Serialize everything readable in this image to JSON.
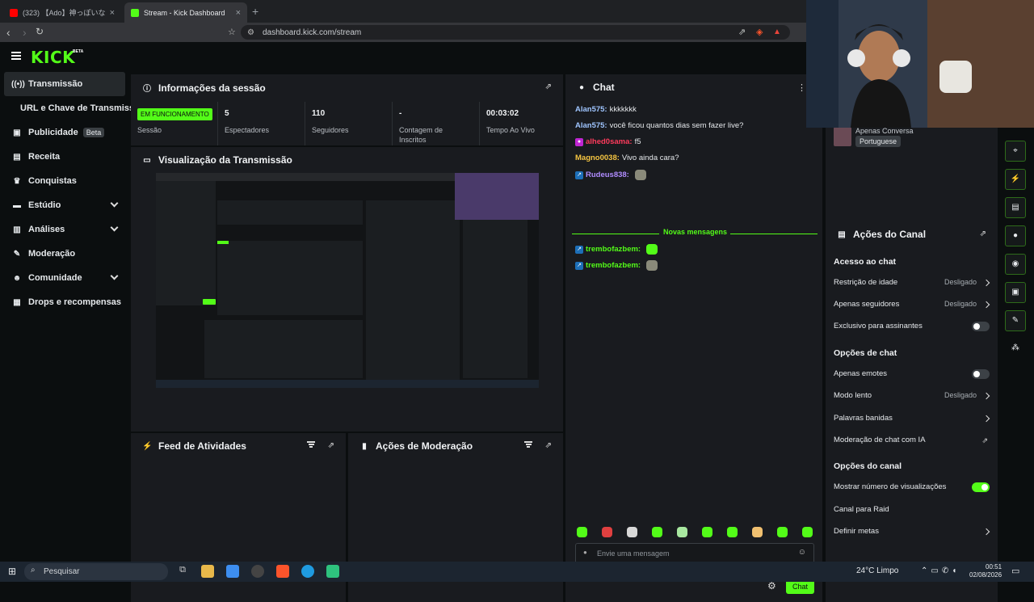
{
  "browser": {
    "tabs": [
      {
        "label": "(323) 【Ado】神っぽいな 歌いました - Yo",
        "favicon_color": "#ff0000"
      },
      {
        "label": "Stream - Kick Dashboard",
        "favicon_color": "#53fc18"
      }
    ],
    "url": "dashboard.kick.com/stream"
  },
  "brand": {
    "logo": "KICK",
    "badge": "BETA",
    "accent": "#53fc18"
  },
  "sidebar": {
    "items": [
      {
        "label": "Transmissão",
        "icon": "broadcast-icon"
      },
      {
        "label": "URL e Chave de Transmissão"
      },
      {
        "label": "Publicidade",
        "badge": "Beta",
        "icon": "megaphone-icon"
      },
      {
        "label": "Receita",
        "icon": "chart-icon"
      },
      {
        "label": "Conquistas",
        "icon": "trophy-icon"
      },
      {
        "label": "Estúdio",
        "icon": "studio-icon"
      },
      {
        "label": "Análises",
        "icon": "analytics-icon"
      },
      {
        "label": "Moderação",
        "icon": "wrench-icon"
      },
      {
        "label": "Comunidade",
        "icon": "community-icon"
      },
      {
        "label": "Drops e recompensas",
        "icon": "drops-icon"
      }
    ]
  },
  "session": {
    "title": "Informações da sessão",
    "status": "EM FUNCIONAMENTO",
    "status_label": "Sessão",
    "viewers": "5",
    "viewers_label": "Espectadores",
    "followers": "110",
    "followers_label": "Seguidores",
    "subs": "-",
    "subs_label": "Contagem de Inscritos",
    "uptime": "00:03:02",
    "uptime_label": "Tempo Ao Vivo"
  },
  "preview": {
    "title": "Visualização da Transmissão"
  },
  "feed": {
    "title": "Feed de Atividades"
  },
  "moderation": {
    "title": "Ações de Moderação"
  },
  "chat": {
    "title": "Chat",
    "messages": [
      {
        "user": "Alan575:",
        "text": "kkkkkkk",
        "color": "#9fc5ff"
      },
      {
        "user": "Alan575:",
        "text": "você ficou quantos dias sem fazer live?",
        "color": "#9fc5ff"
      },
      {
        "user": "alhed0sama:",
        "text": "f5",
        "color": "#ff3b5c"
      },
      {
        "user": "Magno0038:",
        "text": "Vivo ainda cara?",
        "color": "#f5c542"
      },
      {
        "user": "Rudeus838:",
        "text": "",
        "color": "#b08cff"
      },
      {
        "user": "trembofazbem:",
        "text": "",
        "color": "#53fc18"
      },
      {
        "user": "trembofazbem:",
        "text": "",
        "color": "#53fc18"
      }
    ],
    "divider": "Novas mensagens",
    "placeholder": "Envie uma mensagem",
    "send": "Chat"
  },
  "channel": {
    "category": "Apenas Conversa",
    "language": "Portuguese"
  },
  "actions": {
    "title": "Ações do Canal",
    "chat_access": "Acesso ao chat",
    "age_restriction": "Restrição de idade",
    "age_value": "Desligado",
    "followers_only": "Apenas seguidores",
    "followers_value": "Desligado",
    "subs_only": "Exclusivo para assinantes",
    "chat_options": "Opções de chat",
    "emotes_only": "Apenas emotes",
    "slow_mode": "Modo lento",
    "slow_value": "Desligado",
    "banned_words": "Palavras banidas",
    "ai_mod": "Moderação de chat com IA",
    "channel_options": "Opções do canal",
    "show_views": "Mostrar número de visualizações",
    "raid": "Canal para Raid",
    "goals": "Definir metas"
  },
  "taskbar": {
    "search": "Pesquisar",
    "weather": "24°C  Limpo",
    "time": "00:51",
    "date": "02/08/2026"
  }
}
